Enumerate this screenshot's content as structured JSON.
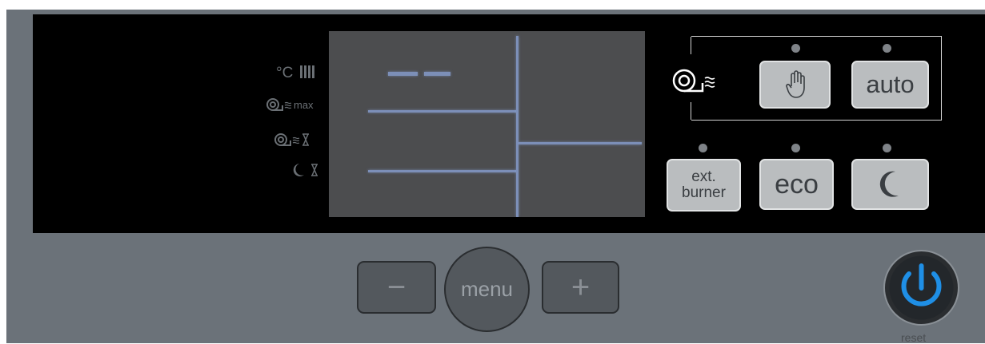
{
  "indicators": {
    "temp_radiator": "°C",
    "max_label": "max"
  },
  "buttons": {
    "manual": "",
    "auto": "auto",
    "ext_burner_line1": "ext.",
    "ext_burner_line2": "burner",
    "eco": "eco",
    "night": ""
  },
  "nav": {
    "minus": "−",
    "menu": "menu",
    "plus": "+"
  },
  "power": {
    "label": "reset"
  },
  "colors": {
    "panel": "#000000",
    "housing": "#6b7279",
    "lcd": "#4c4d4f",
    "lcd_segment": "#7c8fb8",
    "power_ring": "#1f8fe6"
  }
}
